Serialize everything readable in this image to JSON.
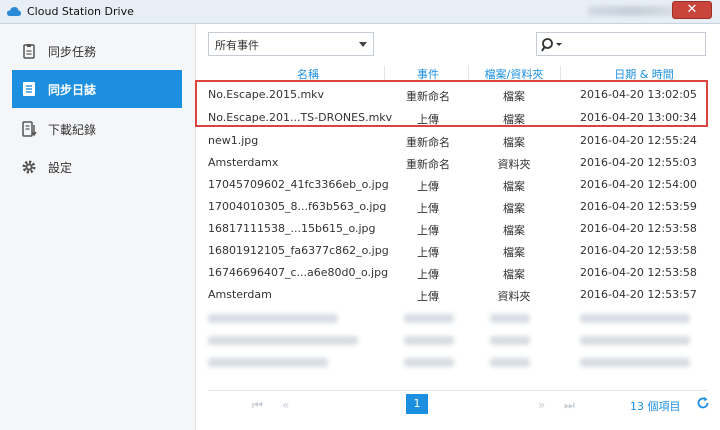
{
  "window": {
    "title": "Cloud Station Drive",
    "close_label": "✕"
  },
  "sidebar": {
    "items": [
      {
        "label": "同步任務",
        "icon": "clipboard-icon",
        "active": false
      },
      {
        "label": "同步日誌",
        "icon": "log-icon",
        "active": true
      },
      {
        "label": "下載紀錄",
        "icon": "download-log-icon",
        "active": false
      },
      {
        "label": "設定",
        "icon": "gear-icon",
        "active": false
      }
    ]
  },
  "toolbar": {
    "filter_value": "所有事件",
    "search_value": ""
  },
  "table": {
    "columns": [
      "名稱",
      "事件",
      "檔案/資料夾",
      "日期 & 時間"
    ],
    "rows": [
      {
        "name": "No.Escape.2015.mkv",
        "event": "重新命名",
        "type": "檔案",
        "date": "2016-04-20 13:02:05"
      },
      {
        "name": "No.Escape.201...TS-DRONES.mkv",
        "event": "上傳",
        "type": "檔案",
        "date": "2016-04-20 13:00:34"
      },
      {
        "name": "new1.jpg",
        "event": "重新命名",
        "type": "檔案",
        "date": "2016-04-20 12:55:24"
      },
      {
        "name": "Amsterdamx",
        "event": "重新命名",
        "type": "資料夾",
        "date": "2016-04-20 12:55:03"
      },
      {
        "name": "17045709602_41fc3366eb_o.jpg",
        "event": "上傳",
        "type": "檔案",
        "date": "2016-04-20 12:54:00"
      },
      {
        "name": "17004010305_8...f63b563_o.jpg",
        "event": "上傳",
        "type": "檔案",
        "date": "2016-04-20 12:53:59"
      },
      {
        "name": "16817111538_...15b615_o.jpg",
        "event": "上傳",
        "type": "檔案",
        "date": "2016-04-20 12:53:58"
      },
      {
        "name": "16801912105_fa6377c862_o.jpg",
        "event": "上傳",
        "type": "檔案",
        "date": "2016-04-20 12:53:58"
      },
      {
        "name": "16746696407_c...a6e80d0_o.jpg",
        "event": "上傳",
        "type": "檔案",
        "date": "2016-04-20 12:53:58"
      },
      {
        "name": "Amsterdam",
        "event": "上傳",
        "type": "資料夾",
        "date": "2016-04-20 12:53:57"
      }
    ]
  },
  "pager": {
    "first": "⏮",
    "prev": "«",
    "current_page": "1",
    "next": "»",
    "last": "⏭",
    "count_label": "13 個項目"
  },
  "colors": {
    "accent": "#1d8fe1",
    "highlight": "#d9453e"
  }
}
